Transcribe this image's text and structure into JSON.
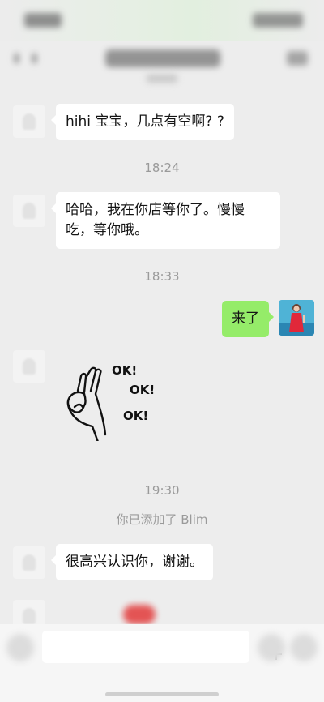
{
  "status_bar": {
    "time": "",
    "icons": [
      "signal-icon",
      "wifi-icon",
      "battery-icon"
    ]
  },
  "nav": {
    "title": "",
    "back_icon": "back-arrow-icon",
    "more_icon": "more-icon"
  },
  "messages": [
    {
      "kind": "timestamp",
      "text": ""
    },
    {
      "kind": "text",
      "side": "left",
      "text": "hihi 宝宝，几点有空啊? ?"
    },
    {
      "kind": "timestamp",
      "text": "18:24"
    },
    {
      "kind": "text",
      "side": "left",
      "lines": [
        "哈哈，我在你店等你了。慢慢",
        "吃，等你哦。"
      ]
    },
    {
      "kind": "timestamp",
      "text": "18:33"
    },
    {
      "kind": "text",
      "side": "right",
      "text": "来了"
    },
    {
      "kind": "sticker",
      "side": "left",
      "labels": [
        "OK!",
        "OK!",
        "OK!"
      ],
      "icon": "ok-hand-sticker"
    },
    {
      "kind": "timestamp",
      "text": "19:30"
    },
    {
      "kind": "system",
      "text": "你已添加了 Blim"
    },
    {
      "kind": "text",
      "side": "left",
      "text": "很高兴认识你，谢谢。"
    }
  ],
  "input_bar": {
    "voice_icon": "voice-icon",
    "emoji_icon": "emoji-icon",
    "plus_icon": "plus-icon"
  },
  "colors": {
    "background": "#ededed",
    "bubble_left": "#ffffff",
    "bubble_right": "#95ec69",
    "timestamp_text": "#9a9a9a"
  }
}
